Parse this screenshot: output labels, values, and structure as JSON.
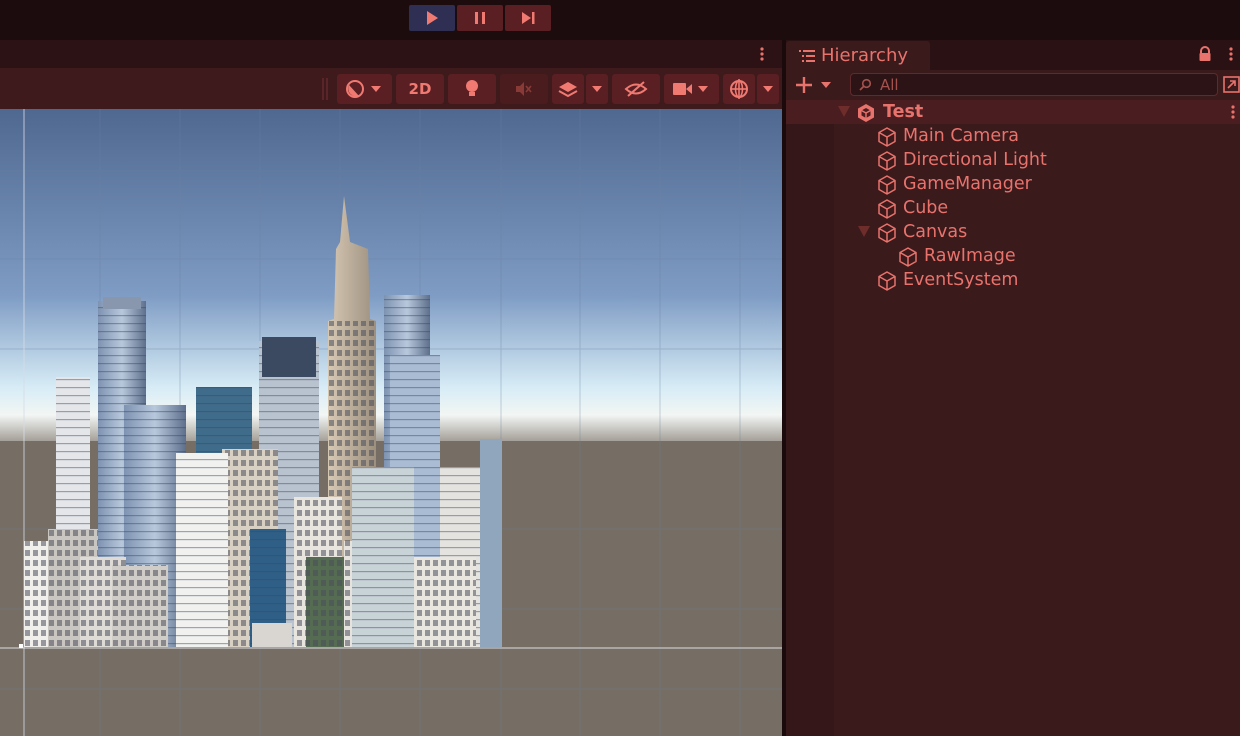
{
  "toolbar": {
    "play_controls": [
      {
        "name": "play-icon",
        "active": true
      },
      {
        "name": "pause-icon",
        "active": false
      },
      {
        "name": "step-icon",
        "active": false
      }
    ],
    "scene_buttons": {
      "draw_mode_icon": "draw-mode-icon",
      "mode_2d_label": "2D",
      "lighting_icon": "lightbulb-icon",
      "audio_icon": "audio-mute-icon",
      "effects_icon": "effects-layers-icon",
      "visibility_icon": "hidden-eye-icon",
      "camera_icon": "camera-icon",
      "gizmos_icon": "gizmos-globe-icon"
    }
  },
  "hierarchy": {
    "tab_label": "Hierarchy",
    "search_placeholder": "All",
    "root": {
      "label": "Test",
      "expanded": true
    },
    "items": [
      {
        "label": "Main Camera"
      },
      {
        "label": "Directional Light"
      },
      {
        "label": "GameManager"
      },
      {
        "label": "Cube"
      },
      {
        "label": "Canvas",
        "expanded": true
      },
      {
        "label": "RawImage"
      },
      {
        "label": "EventSystem"
      }
    ]
  },
  "colors": {
    "accent_text": "#e8726c",
    "panel_bg": "#3b1a1c",
    "play_active": "#2e2f52"
  }
}
